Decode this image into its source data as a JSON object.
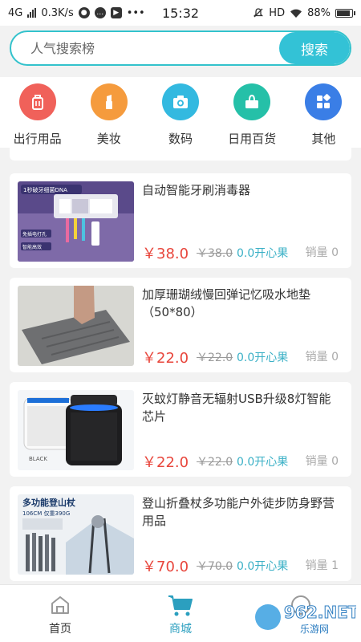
{
  "status": {
    "network": "4G",
    "speed": "0.3K/s",
    "time": "15:32",
    "hd": "HD",
    "battery": "88%",
    "battery_level": 0.88
  },
  "search": {
    "placeholder": "人气搜索榜",
    "button_label": "搜索"
  },
  "categories": [
    {
      "label": "出行用品",
      "color": "#f0615a",
      "icon": "luggage-icon"
    },
    {
      "label": "美妆",
      "color": "#f59b3d",
      "icon": "lipstick-icon"
    },
    {
      "label": "数码",
      "color": "#33b9e0",
      "icon": "camera-icon"
    },
    {
      "label": "日用百货",
      "color": "#25c0a8",
      "icon": "tissue-box-icon"
    },
    {
      "label": "其他",
      "color": "#3a7ee6",
      "icon": "grid-icon"
    }
  ],
  "products": [
    {
      "title": "自动智能牙刷消毒器",
      "price": "￥38.0",
      "old_price": "￥38.0",
      "coins": "0.0开心果",
      "sales": "销量 0",
      "image_text": [
        "1秒破牙细菌DNA",
        "免插电打孔",
        "智能高效"
      ]
    },
    {
      "title": "加厚珊瑚绒慢回弹记忆吸水地垫（50*80）",
      "price": "￥22.0",
      "old_price": "￥22.0",
      "coins": "0.0开心果",
      "sales": "销量 0",
      "image_text": []
    },
    {
      "title": "灭蚊灯静音无辐射USB升级8灯智能芯片",
      "price": "￥22.0",
      "old_price": "￥22.0",
      "coins": "0.0开心果",
      "sales": "销量 0",
      "image_text": [
        "BLACK"
      ]
    },
    {
      "title": "登山折叠杖多功能户外徒步防身野营用品",
      "price": "￥70.0",
      "old_price": "￥70.0",
      "coins": "0.0开心果",
      "sales": "销量 1",
      "image_text": [
        "多功能登山杖",
        "106CM 仅重390G"
      ]
    }
  ],
  "nav": {
    "home_label": "首页",
    "mall_label": "商城"
  },
  "colors": {
    "accent": "#33c2d6",
    "price": "#e8463c",
    "coin": "#3ab0c6",
    "active_tab": "#2b9fbf"
  },
  "watermark": {
    "text": "962.NET",
    "subtext": "乐游网"
  }
}
